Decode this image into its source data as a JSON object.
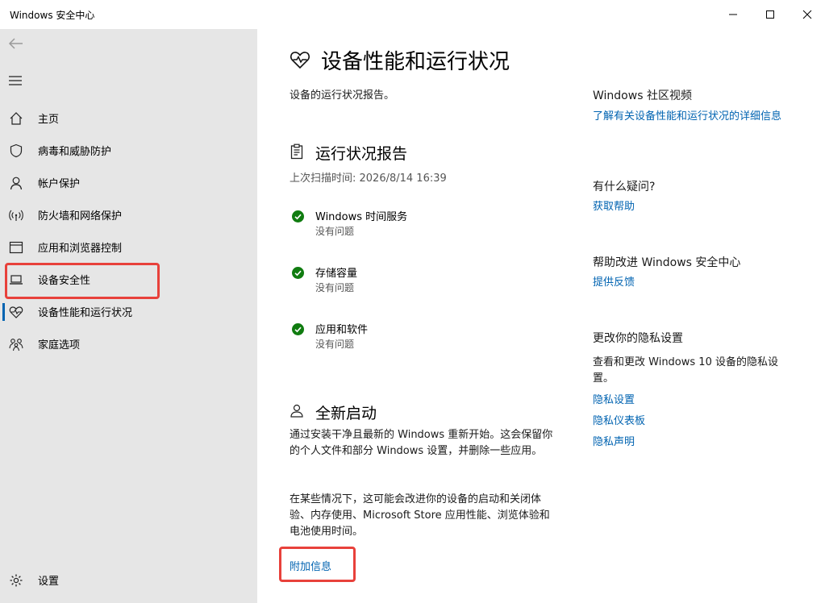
{
  "window": {
    "title": "Windows 安全中心"
  },
  "sidebar": {
    "items": [
      {
        "label": "主页",
        "icon": "home-icon"
      },
      {
        "label": "病毒和威胁防护",
        "icon": "shield-icon"
      },
      {
        "label": "帐户保护",
        "icon": "person-icon"
      },
      {
        "label": "防火墙和网络保护",
        "icon": "wifi-signal-icon"
      },
      {
        "label": "应用和浏览器控制",
        "icon": "browser-window-icon"
      },
      {
        "label": "设备安全性",
        "icon": "laptop-icon"
      },
      {
        "label": "设备性能和运行状况",
        "icon": "heart-pulse-icon",
        "active": true
      },
      {
        "label": "家庭选项",
        "icon": "family-icon"
      }
    ],
    "settings_label": "设置"
  },
  "main": {
    "title": "设备性能和运行状况",
    "subtitle": "设备的运行状况报告。",
    "report": {
      "title": "运行状况报告",
      "last_scan": "上次扫描时间: 2026/8/14 16:39",
      "items": [
        {
          "name": "Windows 时间服务",
          "state": "没有问题"
        },
        {
          "name": "存储容量",
          "state": "没有问题"
        },
        {
          "name": "应用和软件",
          "state": "没有问题"
        }
      ]
    },
    "fresh_start": {
      "title": "全新启动",
      "para1": "通过安装干净且最新的 Windows 重新开始。这会保留你的个人文件和部分 Windows 设置，并删除一些应用。",
      "para2": "在某些情况下，这可能会改进你的设备的启动和关闭体验、内存使用、Microsoft Store 应用性能、浏览体验和电池使用时间。",
      "more_info": "附加信息"
    }
  },
  "right": {
    "community": {
      "heading": "Windows 社区视频",
      "link": "了解有关设备性能和运行状况的详细信息"
    },
    "help": {
      "heading": "有什么疑问?",
      "link": "获取帮助"
    },
    "improve": {
      "heading": "帮助改进 Windows 安全中心",
      "link": "提供反馈"
    },
    "privacy": {
      "heading": "更改你的隐私设置",
      "text": "查看和更改 Windows 10 设备的隐私设置。",
      "links": [
        "隐私设置",
        "隐私仪表板",
        "隐私声明"
      ]
    }
  },
  "colors": {
    "accent": "#0063b1",
    "success": "#107c10",
    "annotation": "#e8413b",
    "sidebar_bg": "#e6e6e6"
  }
}
